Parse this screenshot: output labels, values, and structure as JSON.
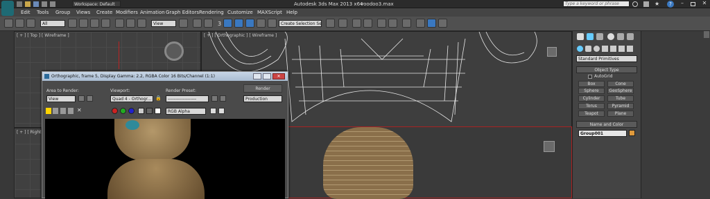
{
  "app": {
    "workspace": "Workspace: Default",
    "title": "Autodesk 3ds Max  2013 x64",
    "file": "voodoo3.max",
    "search_placeholder": "Type a keyword or phrase"
  },
  "menu": [
    "Edit",
    "Tools",
    "Group",
    "Views",
    "Create",
    "Modifiers",
    "Animation",
    "Graph Editors",
    "Rendering",
    "Customize",
    "MAXScript",
    "Help"
  ],
  "toolbar": {
    "filter": "All",
    "view": "View",
    "selection_set": "Create Selection Se",
    "snap_count": "3"
  },
  "viewports": {
    "top": "[ + ] [ Top ] [ Wireframe ]",
    "persp": "[ + ] [ Orthographic ] [ Wireframe ]",
    "right": "[ + ] [ Right ] [ W"
  },
  "render_window": {
    "title": "Orthographic, frame 5, Display Gamma: 2.2, RGBA Color 16 Bits/Channel (1:1)",
    "area_label": "Area to Render:",
    "area_value": "View",
    "viewport_label": "Viewport:",
    "viewport_value": "Quad 4 - Orthogr...",
    "preset_label": "Render Preset:",
    "preset_value": "-------------------",
    "render_button": "Render",
    "mode_value": "Production",
    "channel_value": "RGB Alpha"
  },
  "command_panel": {
    "category": "Standard Primitives",
    "object_type_title": "Object Type",
    "autogrid": "AutoGrid",
    "buttons": [
      "Box",
      "Cone",
      "Sphere",
      "GeoSphere",
      "Cylinder",
      "Tube",
      "Torus",
      "Pyramid",
      "Teapot",
      "Plane"
    ],
    "name_color_title": "Name and Color",
    "object_name": "Group001",
    "object_color": "#e09a3c"
  }
}
